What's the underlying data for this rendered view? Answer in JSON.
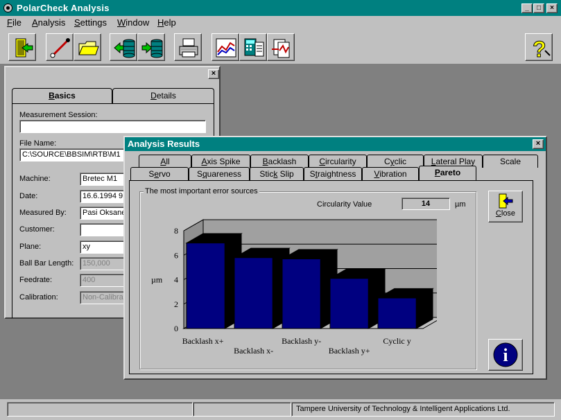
{
  "app": {
    "title": "PolarCheck Analysis"
  },
  "window_buttons": {
    "minimize": "_",
    "maximize": "□",
    "close": "×"
  },
  "menu": [
    {
      "pre": "",
      "key": "F",
      "post": "ile"
    },
    {
      "pre": "",
      "key": "A",
      "post": "nalysis"
    },
    {
      "pre": "",
      "key": "S",
      "post": "ettings"
    },
    {
      "pre": "",
      "key": "W",
      "post": "indow"
    },
    {
      "pre": "",
      "key": "H",
      "post": "elp"
    }
  ],
  "toolbar": {
    "icons": [
      "exit-door-icon",
      "compass-icon",
      "open-folder-icon",
      "import-database-icon",
      "export-database-icon",
      "printer-icon",
      "chart-icon",
      "calculator-icon",
      "compare-icon",
      "help-icon"
    ],
    "help_glyph": "?"
  },
  "basics_window": {
    "close_glyph": "×",
    "tabs": [
      {
        "pre": "",
        "key": "B",
        "post": "asics",
        "active": true
      },
      {
        "pre": "",
        "key": "D",
        "post": "etails",
        "active": false
      }
    ],
    "measurement_session_label": "Measurement Session:",
    "measurement_session_value": "",
    "file_name_label": "File Name:",
    "file_name_value": "C:\\SOURCE\\BBSIM\\RTB\\M1",
    "fields": [
      {
        "label": "Machine:",
        "value": "Bretec M1",
        "disabled": false
      },
      {
        "label": "Date:",
        "value": "16.6.1994 9:",
        "disabled": false
      },
      {
        "label": "Measured By:",
        "value": "Pasi Oksane",
        "disabled": false
      },
      {
        "label": "Customer:",
        "value": "",
        "disabled": false
      },
      {
        "label": "Plane:",
        "value": "xy",
        "disabled": false
      },
      {
        "label": "Ball Bar Length:",
        "value": "150,000",
        "disabled": true
      },
      {
        "label": "Feedrate:",
        "value": "400",
        "disabled": true
      },
      {
        "label": "Calibration:",
        "value": "Non-Calibrat",
        "disabled": true
      }
    ]
  },
  "results_window": {
    "title": "Analysis Results",
    "close_glyph": "×",
    "tabs_row1": [
      {
        "pre": "",
        "key": "A",
        "post": "ll"
      },
      {
        "pre": "",
        "key": "A",
        "post": "xis Spike"
      },
      {
        "pre": "",
        "key": "B",
        "post": "acklash"
      },
      {
        "pre": "",
        "key": "C",
        "post": "ircularity"
      },
      {
        "pre": "C",
        "key": "y",
        "post": "clic"
      },
      {
        "pre": "",
        "key": "L",
        "post": "ateral Play"
      },
      {
        "pre": "",
        "key": "",
        "post": "Scale"
      }
    ],
    "tabs_row2": [
      {
        "pre": "S",
        "key": "e",
        "post": "rvo"
      },
      {
        "pre": "S",
        "key": "q",
        "post": "uareness"
      },
      {
        "pre": "Stic",
        "key": "k",
        "post": " Slip"
      },
      {
        "pre": "S",
        "key": "t",
        "post": "raightness"
      },
      {
        "pre": "",
        "key": "V",
        "post": "ibration"
      },
      {
        "pre": "",
        "key": "P",
        "post": "areto",
        "active": true
      }
    ],
    "group_title": "The most important error sources",
    "circularity_label": "Circularity Value",
    "circularity_value": "14",
    "circularity_unit": "µm",
    "close_button": {
      "pre": "",
      "key": "C",
      "post": "lose"
    },
    "info_glyph": "i"
  },
  "chart_data": {
    "type": "bar",
    "categories": [
      "Backlash x+",
      "Backlash x-",
      "Backlash y-",
      "Backlash y+",
      "Cyclic y"
    ],
    "values": [
      7.0,
      5.8,
      5.7,
      4.1,
      2.5
    ],
    "ylabel": "µm",
    "ylim": [
      0,
      8
    ],
    "yticks": [
      "0",
      "2",
      "4",
      "6",
      "8"
    ],
    "grid": true,
    "bar_color": "#000080",
    "style": "3d"
  },
  "status": {
    "text": "Tampere University of Technology & Intelligent Applications Ltd."
  },
  "colors": {
    "title_bar": "#008080",
    "face": "#c0c0c0",
    "bar": "#000080",
    "desktop": "#808080"
  }
}
